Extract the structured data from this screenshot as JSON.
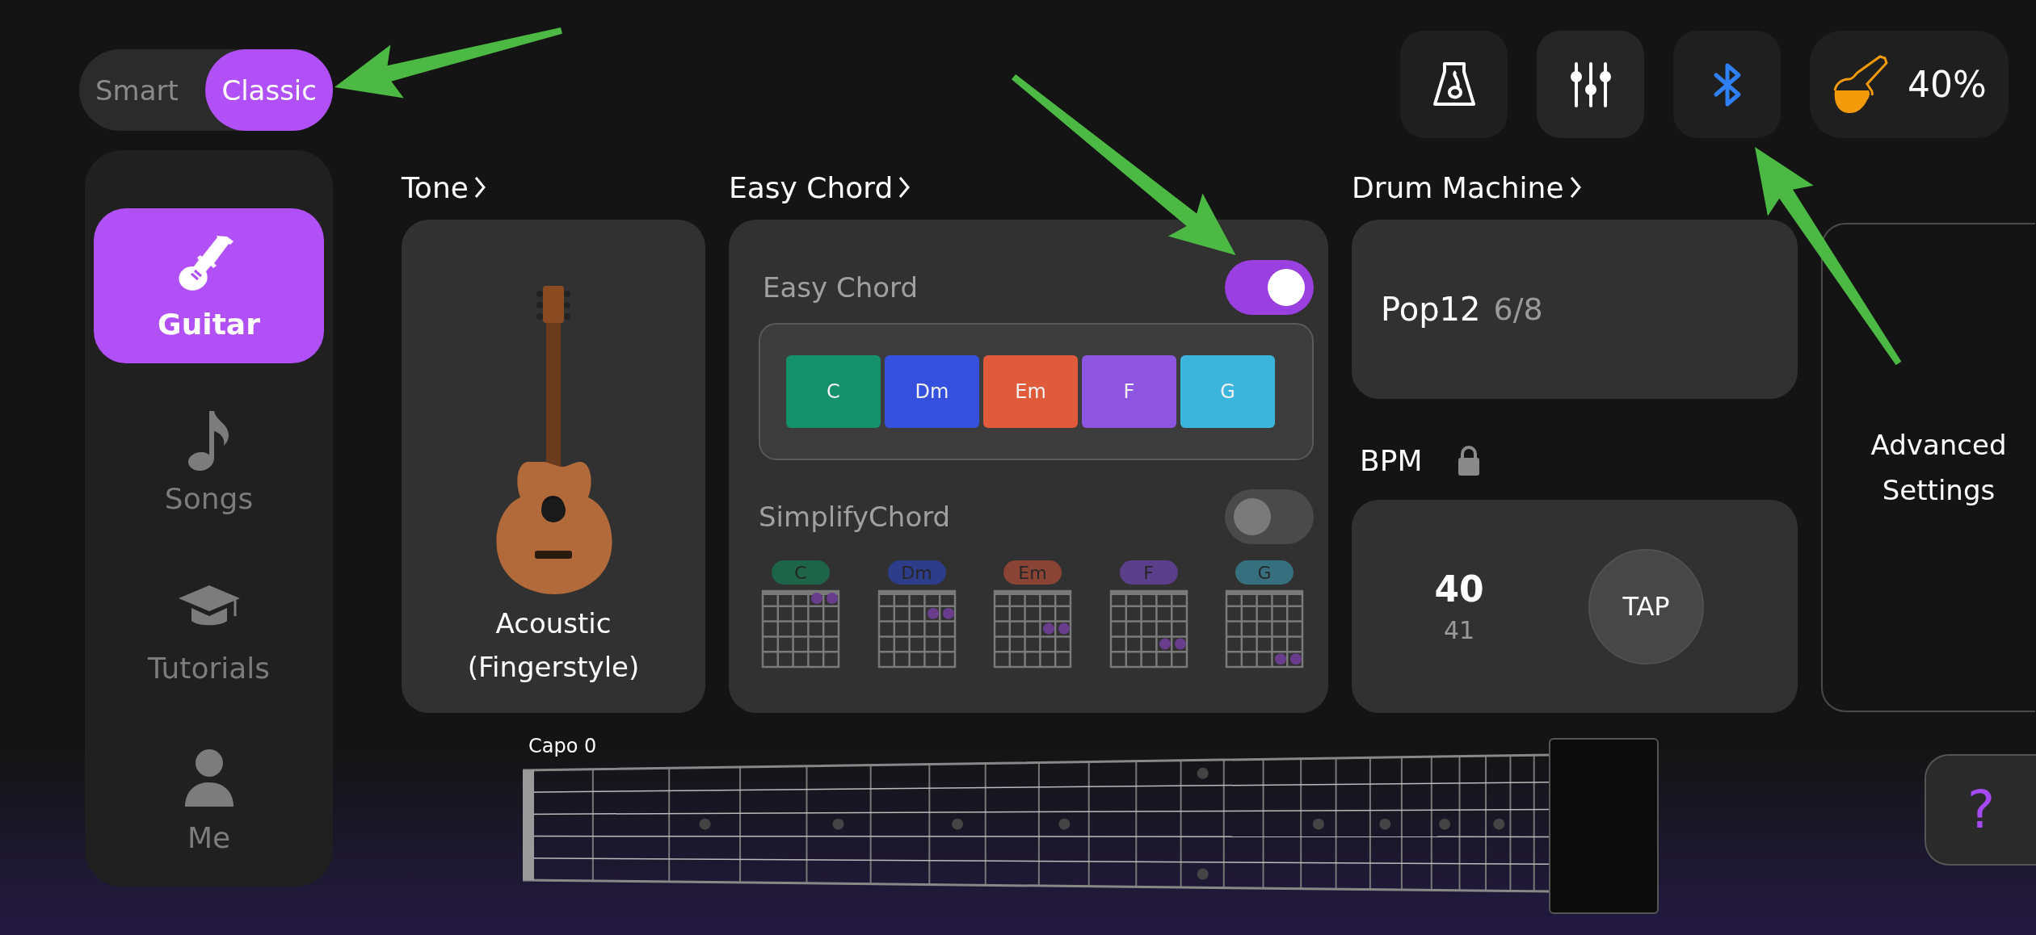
{
  "mode_toggle": [
    {
      "label": "Smart",
      "selected": false
    },
    {
      "label": "Classic",
      "selected": true
    }
  ],
  "toolbar": {
    "buttons": [
      {
        "kind": "metronome"
      },
      {
        "kind": "mixer"
      },
      {
        "kind": "bluetooth"
      }
    ],
    "battery": {
      "reading": "40%"
    }
  },
  "sidebar": {
    "items": [
      {
        "kind": "guitar",
        "label": "Guitar",
        "selected": true
      },
      {
        "kind": "songs",
        "label": "Songs",
        "selected": false
      },
      {
        "kind": "tutorials",
        "label": "Tutorials",
        "selected": false
      },
      {
        "kind": "me",
        "label": "Me",
        "selected": false
      }
    ]
  },
  "tone": {
    "title": "Tone",
    "instrument": "Acoustic (Fingerstyle)"
  },
  "easy_chord": {
    "title": "Easy Chord",
    "toggle_label": "Easy Chord",
    "on": true,
    "chords": [
      {
        "label": "C",
        "color": "#14906a"
      },
      {
        "label": "Dm",
        "color": "#3450dd"
      },
      {
        "label": "Em",
        "color": "#e05a3c"
      },
      {
        "label": "F",
        "color": "#8e55e0"
      },
      {
        "label": "G",
        "color": "#3bb5dc"
      }
    ],
    "simplify": {
      "label": "SimplifyChord",
      "on": false
    },
    "diagrams": [
      {
        "label": "C",
        "color": "#1d6448"
      },
      {
        "label": "Dm",
        "color": "#2e3d8a"
      },
      {
        "label": "Em",
        "color": "#8a4436"
      },
      {
        "label": "F",
        "color": "#5c3f8a"
      },
      {
        "label": "G",
        "color": "#36707f"
      }
    ]
  },
  "drum_machine": {
    "title": "Drum Machine",
    "pattern": "Pop12",
    "meter": "6/8"
  },
  "bpm": {
    "title": "BPM",
    "locked": true,
    "value": "40",
    "next_value": "41",
    "tap_label": "TAP"
  },
  "advanced_settings": {
    "label": "Advanced Settings"
  },
  "fretboard": {
    "capo_label": "Capo 0"
  },
  "help_button": {
    "label": "?"
  }
}
